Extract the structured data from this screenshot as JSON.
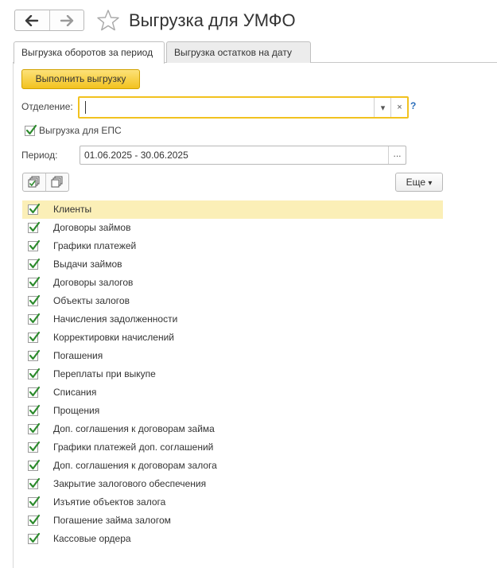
{
  "window": {
    "title": "Выгрузка для УМФО",
    "nav_back_icon": "arrow-left-icon",
    "nav_forward_icon": "arrow-right-icon",
    "favorite_icon": "star-icon"
  },
  "tabs": [
    {
      "label": "Выгрузка оборотов за период",
      "active": true
    },
    {
      "label": "Выгрузка остатков на дату",
      "active": false
    }
  ],
  "form": {
    "run_button": "Выполнить выгрузку",
    "department_label": "Отделение:",
    "department_value": "",
    "help_label": "?",
    "eps_label": "Выгрузка для ЕПС",
    "eps_checked": true,
    "period_label": "Период:",
    "period_value": "01.06.2025 - 30.06.2025",
    "period_button": "...",
    "more_button": "Еще",
    "dropdown_glyph": "▾",
    "clear_glyph": "×"
  },
  "colors": {
    "accent": "#f2c21f",
    "check": "#2e8b2e",
    "selected_row": "#fbefb7",
    "help": "#2a6ebb"
  },
  "items": [
    {
      "label": "Клиенты",
      "checked": true,
      "selected": true
    },
    {
      "label": "Договоры займов",
      "checked": true
    },
    {
      "label": "Графики платежей",
      "checked": true
    },
    {
      "label": "Выдачи займов",
      "checked": true
    },
    {
      "label": "Договоры залогов",
      "checked": true
    },
    {
      "label": "Объекты залогов",
      "checked": true
    },
    {
      "label": "Начисления задолженности",
      "checked": true
    },
    {
      "label": "Корректировки начислений",
      "checked": true
    },
    {
      "label": "Погашения",
      "checked": true
    },
    {
      "label": "Переплаты при выкупе",
      "checked": true
    },
    {
      "label": "Списания",
      "checked": true
    },
    {
      "label": "Прощения",
      "checked": true
    },
    {
      "label": "Доп. соглашения к договорам займа",
      "checked": true
    },
    {
      "label": "Графики платежей доп. соглашений",
      "checked": true
    },
    {
      "label": "Доп. соглашения к договорам залога",
      "checked": true
    },
    {
      "label": "Закрытие залогового обеспечения",
      "checked": true
    },
    {
      "label": "Изъятие объектов залога",
      "checked": true
    },
    {
      "label": "Погашение займа залогом",
      "checked": true
    },
    {
      "label": "Кассовые ордера",
      "checked": true
    }
  ]
}
